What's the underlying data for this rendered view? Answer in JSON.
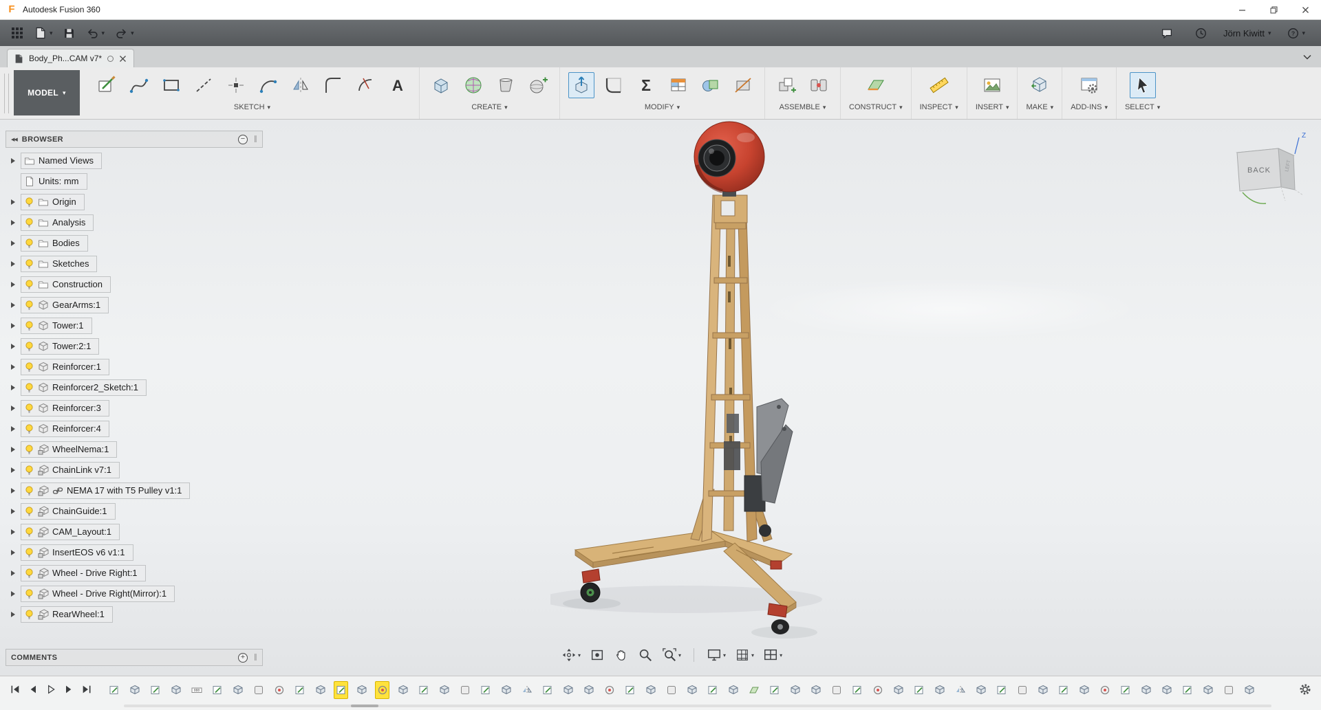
{
  "window": {
    "app_title": "Autodesk Fusion 360"
  },
  "appbar": {
    "user_name": "Jörn Kiwitt"
  },
  "document_tab": {
    "label": "Body_Ph...CAM v7*"
  },
  "ribbon": {
    "workspace": "MODEL",
    "groups": [
      {
        "label": "SKETCH",
        "tools": [
          {
            "name": "create-sketch",
            "icon": "sketch"
          },
          {
            "name": "spline",
            "icon": "spline"
          },
          {
            "name": "rectangle",
            "icon": "rect"
          },
          {
            "name": "construction-line",
            "icon": "line"
          },
          {
            "name": "sketch-point",
            "icon": "point"
          },
          {
            "name": "arc",
            "icon": "arc"
          },
          {
            "name": "sketch-mirror",
            "icon": "mirror"
          },
          {
            "name": "sketch-fillet",
            "icon": "filletsk"
          },
          {
            "name": "trim",
            "icon": "trim"
          },
          {
            "name": "sketch-text",
            "icon": "text"
          }
        ]
      },
      {
        "label": "CREATE",
        "tools": [
          {
            "name": "extrude",
            "icon": "box"
          },
          {
            "name": "create-form",
            "icon": "form"
          },
          {
            "name": "loft",
            "icon": "loft"
          },
          {
            "name": "sphere",
            "icon": "spherep"
          }
        ]
      },
      {
        "label": "MODIFY",
        "tools": [
          {
            "name": "press-pull",
            "icon": "presspull",
            "active": true
          },
          {
            "name": "fillet",
            "icon": "fillet"
          },
          {
            "name": "change-parameters",
            "icon": "sigma"
          },
          {
            "name": "manage-materials",
            "icon": "params"
          },
          {
            "name": "combine",
            "icon": "combine"
          },
          {
            "name": "split-body",
            "icon": "splitb"
          }
        ]
      },
      {
        "label": "ASSEMBLE",
        "tools": [
          {
            "name": "new-component",
            "icon": "newcomp"
          },
          {
            "name": "joint",
            "icon": "joint"
          }
        ]
      },
      {
        "label": "CONSTRUCT",
        "tools": [
          {
            "name": "construction-plane",
            "icon": "cplane"
          }
        ]
      },
      {
        "label": "INSPECT",
        "tools": [
          {
            "name": "measure",
            "icon": "measure"
          }
        ]
      },
      {
        "label": "INSERT",
        "tools": [
          {
            "name": "insert-canvas",
            "icon": "canvas"
          }
        ]
      },
      {
        "label": "MAKE",
        "tools": [
          {
            "name": "make-3d-print",
            "icon": "make"
          }
        ]
      },
      {
        "label": "ADD-INS",
        "tools": [
          {
            "name": "scripts-and-addins",
            "icon": "addins"
          }
        ]
      },
      {
        "label": "SELECT",
        "tools": [
          {
            "name": "select",
            "icon": "cursor",
            "active": true
          }
        ]
      }
    ]
  },
  "browser": {
    "title": "BROWSER",
    "items": [
      {
        "label": "Named Views",
        "icon": "folder",
        "bulb": false,
        "expand": true
      },
      {
        "label": "Units: mm",
        "icon": "document",
        "bulb": false,
        "expand": false
      },
      {
        "label": "Origin",
        "icon": "folder",
        "bulb": true,
        "expand": true
      },
      {
        "label": "Analysis",
        "icon": "folder",
        "bulb": true,
        "expand": true
      },
      {
        "label": "Bodies",
        "icon": "folder",
        "bulb": true,
        "expand": true
      },
      {
        "label": "Sketches",
        "icon": "folder",
        "bulb": true,
        "expand": true
      },
      {
        "label": "Construction",
        "icon": "folder",
        "bulb": true,
        "expand": true
      },
      {
        "label": "GearArms:1",
        "icon": "component",
        "bulb": true,
        "expand": true
      },
      {
        "label": "Tower:1",
        "icon": "component",
        "bulb": true,
        "expand": true
      },
      {
        "label": "Tower:2:1",
        "icon": "component",
        "bulb": true,
        "expand": true
      },
      {
        "label": "Reinforcer:1",
        "icon": "component",
        "bulb": true,
        "expand": true
      },
      {
        "label": "Reinforcer2_Sketch:1",
        "icon": "component",
        "bulb": true,
        "expand": true
      },
      {
        "label": "Reinforcer:3",
        "icon": "component",
        "bulb": true,
        "expand": true
      },
      {
        "label": "Reinforcer:4",
        "icon": "component",
        "bulb": true,
        "expand": true
      },
      {
        "label": "WheelNema:1",
        "icon": "assembly",
        "bulb": true,
        "expand": true
      },
      {
        "label": "ChainLink v7:1",
        "icon": "assembly",
        "bulb": true,
        "expand": true
      },
      {
        "label": "NEMA 17 with T5 Pulley v1:1",
        "icon": "assembly",
        "bulb": true,
        "expand": true,
        "linked": true
      },
      {
        "label": "ChainGuide:1",
        "icon": "assembly",
        "bulb": true,
        "expand": true
      },
      {
        "label": "CAM_Layout:1",
        "icon": "assembly",
        "bulb": true,
        "expand": true
      },
      {
        "label": "InsertEOS v6 v1:1",
        "icon": "assembly",
        "bulb": true,
        "expand": true
      },
      {
        "label": "Wheel - Drive Right:1",
        "icon": "assembly",
        "bulb": true,
        "expand": true
      },
      {
        "label": "Wheel - Drive Right(Mirror):1",
        "icon": "assembly",
        "bulb": true,
        "expand": true
      },
      {
        "label": "RearWheel:1",
        "icon": "assembly",
        "bulb": true,
        "expand": true
      }
    ]
  },
  "comments": {
    "title": "COMMENTS"
  },
  "viewcube": {
    "front_label": "BACK",
    "side_label": "LEFT",
    "axis_label": "Z"
  },
  "navbar": {
    "tools": [
      {
        "name": "orbit",
        "icon": "orbit",
        "dropdown": true
      },
      {
        "name": "look-at",
        "icon": "lookat",
        "dropdown": false
      },
      {
        "name": "pan",
        "icon": "hand",
        "dropdown": false
      },
      {
        "name": "zoom",
        "icon": "zoom",
        "dropdown": false
      },
      {
        "name": "fit",
        "icon": "fit",
        "dropdown": true
      },
      {
        "name": "separator"
      },
      {
        "name": "display-settings",
        "icon": "display",
        "dropdown": true
      },
      {
        "name": "grid-and-snaps",
        "icon": "gridsnap",
        "dropdown": true
      },
      {
        "name": "viewports",
        "icon": "viewports",
        "dropdown": true
      }
    ]
  },
  "timeline": {
    "controls": [
      "go-to-start",
      "step-back",
      "play",
      "step-forward",
      "go-to-end"
    ],
    "features": [
      "sk",
      "ex",
      "sk",
      "ex",
      "pr",
      "sk",
      "ex",
      "cp",
      "jt",
      "sk",
      "ex",
      "sk",
      "ex",
      "jt",
      "ex",
      "sk",
      "ex",
      "cp",
      "sk",
      "ex",
      "mi",
      "sk",
      "ex",
      "ex",
      "jt",
      "sk",
      "ex",
      "cp",
      "ex",
      "sk",
      "ex",
      "pl",
      "sk",
      "ex",
      "ex",
      "cp",
      "sk",
      "jt",
      "ex",
      "sk",
      "ex",
      "mi",
      "ex",
      "sk",
      "cp",
      "ex",
      "sk",
      "ex",
      "jt",
      "sk",
      "ex",
      "ex",
      "sk",
      "ex",
      "cp",
      "ex"
    ],
    "highlighted": [
      11,
      13
    ]
  },
  "colors": {
    "selection_blue": "#4b93c7",
    "timeline_highlight": "#ffe23c",
    "model_head_red": "#c7432f",
    "model_wood_tan": "#d5ae73",
    "bulb_yellow": "#ffd83d"
  }
}
